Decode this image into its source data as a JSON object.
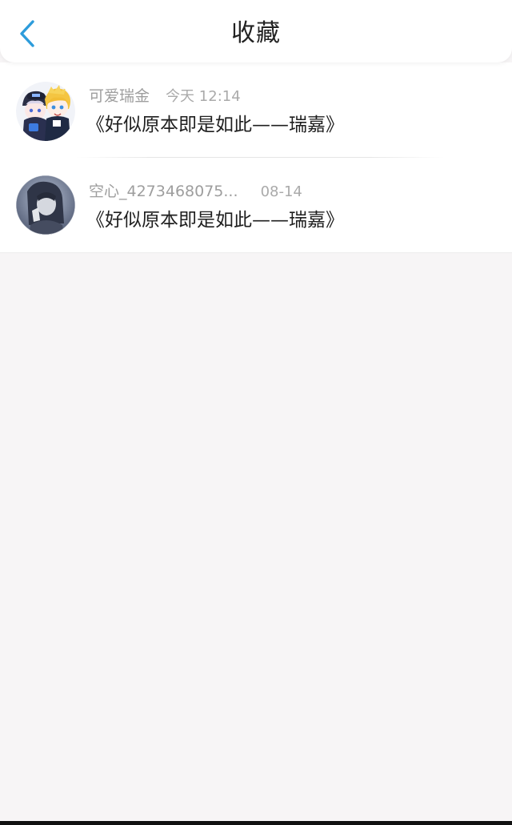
{
  "header": {
    "title": "收藏",
    "back_icon": "chevron-left-icon",
    "accent_color": "#2d9cdb"
  },
  "favorites": [
    {
      "username": "可爱瑞金",
      "time": "今天 12:14",
      "content": "《好似原本即是如此——瑞嘉》",
      "avatar_icon": "anime-characters-avatar"
    },
    {
      "username": "空心_4273468075...",
      "time": "08-14",
      "content": "《好似原本即是如此——瑞嘉》",
      "avatar_icon": "photo-avatar"
    }
  ]
}
